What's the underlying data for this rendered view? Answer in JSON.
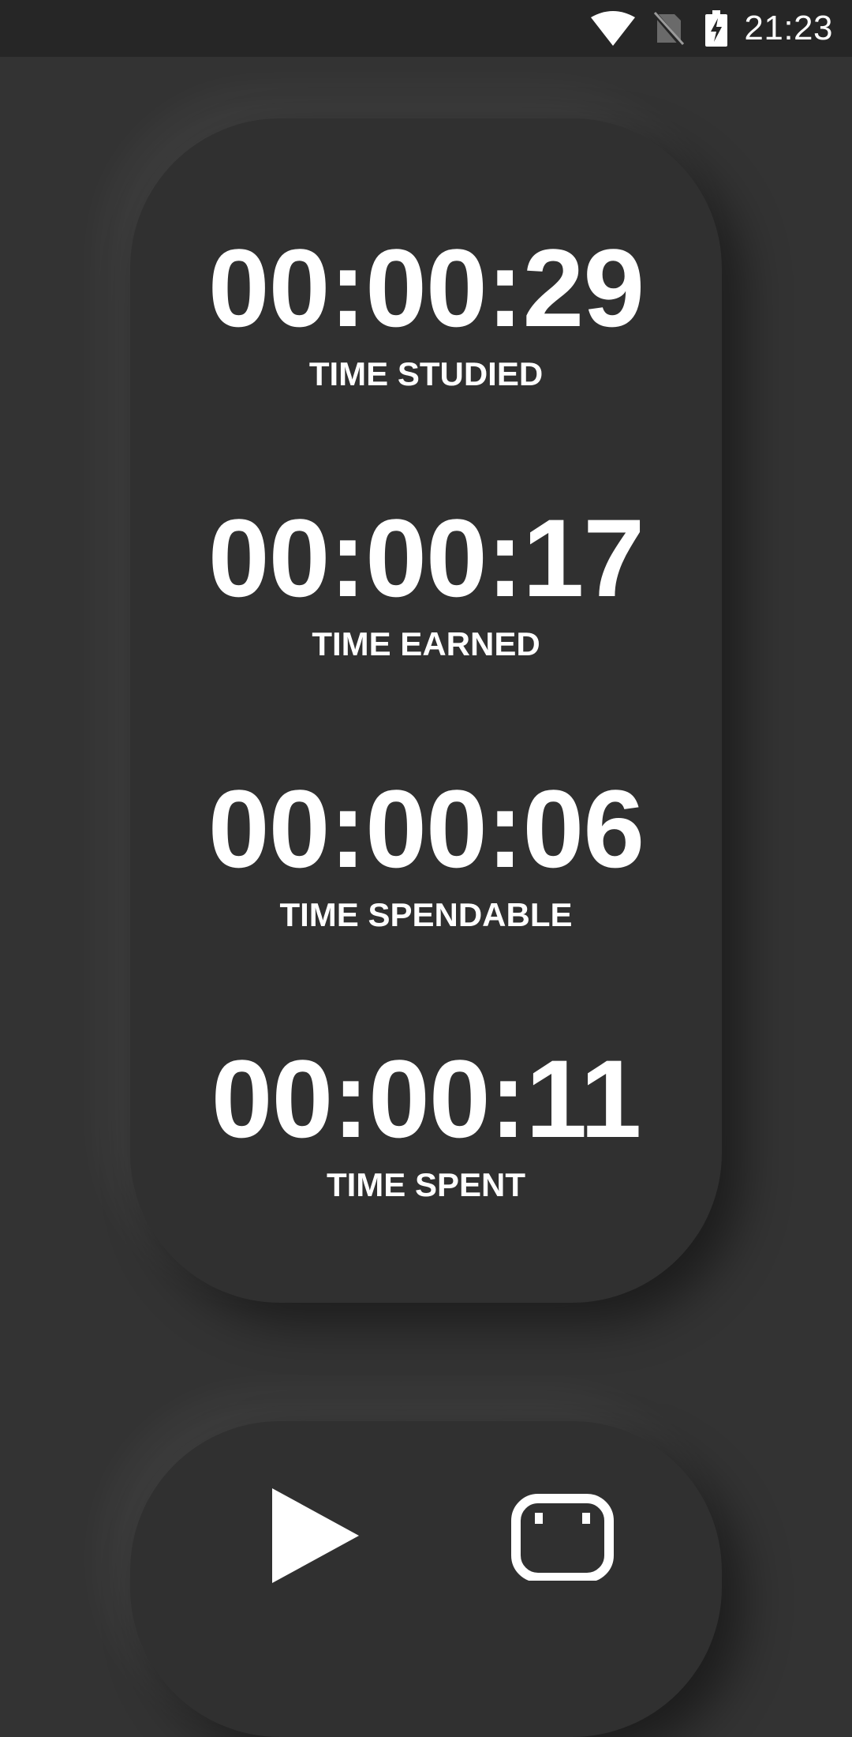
{
  "status_bar": {
    "time": "21:23",
    "icons": [
      "wifi-icon",
      "no-sim-icon",
      "battery-charging-icon"
    ]
  },
  "timers": [
    {
      "value": "00:00:29",
      "label": "TIME STUDIED"
    },
    {
      "value": "00:00:17",
      "label": "TIME EARNED"
    },
    {
      "value": "00:00:06",
      "label": "TIME SPENDABLE"
    },
    {
      "value": "00:00:11",
      "label": "TIME SPENT"
    }
  ],
  "controls": {
    "icons": [
      "play-icon",
      "wallet-icon"
    ]
  },
  "colors": {
    "background": "#333333",
    "status_bar": "#262626",
    "card": "#303030",
    "text": "#ffffff"
  }
}
